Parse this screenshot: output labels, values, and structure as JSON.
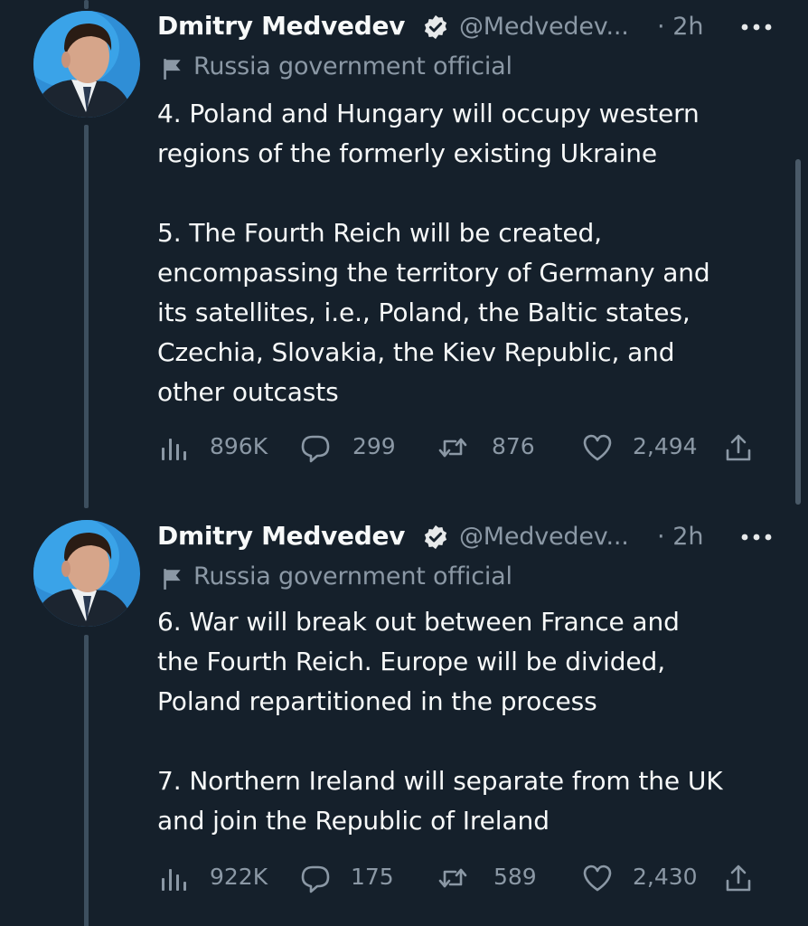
{
  "accent": "#1d9bf0",
  "background": "#15202b",
  "secondary_text_color": "#8b98a5",
  "tweets": [
    {
      "author_name": "Dmitry Medvedev",
      "handle": "@Medvedev...",
      "separator": "·",
      "time": "2h",
      "label": "Russia government official",
      "paragraphs": [
        [
          "4. Poland and Hungary will occupy western",
          "regions of the formerly existing Ukraine"
        ],
        [
          "5. The Fourth Reich will be created,",
          "encompassing the territory of Germany and",
          "its satellites, i.e., Poland, the Baltic states,",
          "Czechia, Slovakia, the Kiev Republic, and",
          "other outcasts"
        ]
      ],
      "views": "896K",
      "replies": "299",
      "retweets": "876",
      "likes": "2,494"
    },
    {
      "author_name": "Dmitry Medvedev",
      "handle": "@Medvedev...",
      "separator": "·",
      "time": "2h",
      "label": "Russia government official",
      "paragraphs": [
        [
          "6. War will break out between France and",
          "the Fourth Reich. Europe will be divided,",
          "Poland repartitioned in the process"
        ],
        [
          "7. Northern Ireland will separate from the UK",
          "and join the Republic of Ireland"
        ]
      ],
      "views": "922K",
      "replies": "175",
      "retweets": "589",
      "likes": "2,430"
    }
  ],
  "icons": {
    "verified": "verified-badge-icon",
    "more": "more-options-icon",
    "label": "flag-icon",
    "views": "views-bar-chart-icon",
    "reply": "reply-bubble-icon",
    "retweet": "retweet-icon",
    "like": "heart-icon",
    "share": "share-icon"
  }
}
